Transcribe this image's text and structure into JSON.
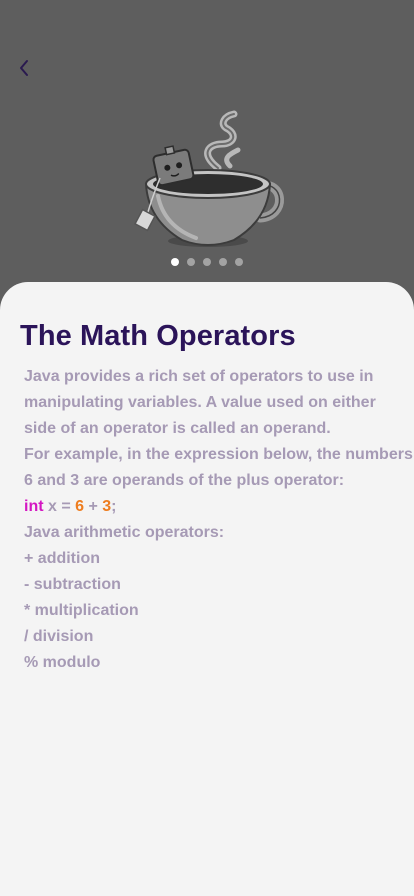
{
  "header": {
    "back_icon": "chevron-left-icon",
    "illustration": "tea-cup-illustration"
  },
  "carousel": {
    "count": 5,
    "active_index": 0
  },
  "lesson": {
    "title": "The Math Operators",
    "intro_lines": [
      "Java provides a rich set of operators to use in",
      "manipulating variables. A value used on either",
      "side of an operator is called an operand.",
      "For example, in the expression below, the numbers",
      "6 and 3 are operands of the plus operator:"
    ],
    "code": {
      "keyword": "int",
      "var": " x = ",
      "left_operand": "6",
      "operator": " + ",
      "right_operand": "3",
      "terminator": ";"
    },
    "operators_heading": "Java arithmetic operators:",
    "operators": [
      "+ addition",
      "- subtraction",
      "* multiplication",
      "/ division",
      "% modulo"
    ]
  },
  "colors": {
    "hero_background": "#5e5e5e",
    "card_background": "#f4f4f4",
    "title": "#2b1459",
    "body_text": "#a69ab5",
    "code_keyword": "#d416c2",
    "code_number": "#ee7d1f",
    "dot_active": "#ffffff",
    "dot_inactive": "#a3a3a3"
  }
}
